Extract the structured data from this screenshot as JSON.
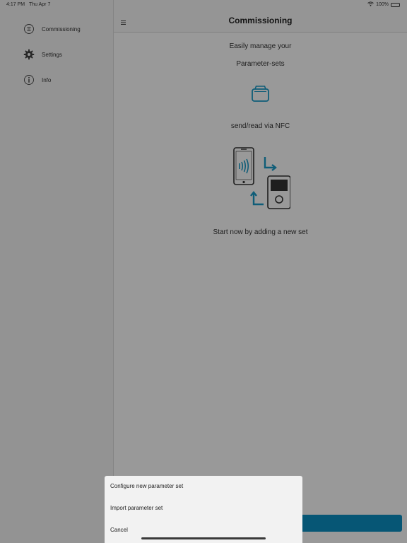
{
  "status_bar": {
    "time": "4:17 PM",
    "date": "Thu Apr 7",
    "battery": "100%"
  },
  "sidebar": {
    "items": [
      {
        "label": "Commissioning",
        "icon": "commissioning-icon"
      },
      {
        "label": "Settings",
        "icon": "gear-icon"
      },
      {
        "label": "Info",
        "icon": "info-icon"
      }
    ]
  },
  "nav": {
    "title": "Commissioning",
    "menu_icon": "hamburger-icon"
  },
  "content": {
    "line1": "Easily manage your",
    "line2": "Parameter-sets",
    "nfc_text": "send/read via NFC",
    "cta_text": "Start now by adding a new set"
  },
  "action_sheet": {
    "options": [
      "Configure new parameter set",
      "Import parameter set",
      "Cancel"
    ]
  },
  "colors": {
    "accent": "#1a9cc9",
    "primary_button": "#0a8fc4"
  }
}
